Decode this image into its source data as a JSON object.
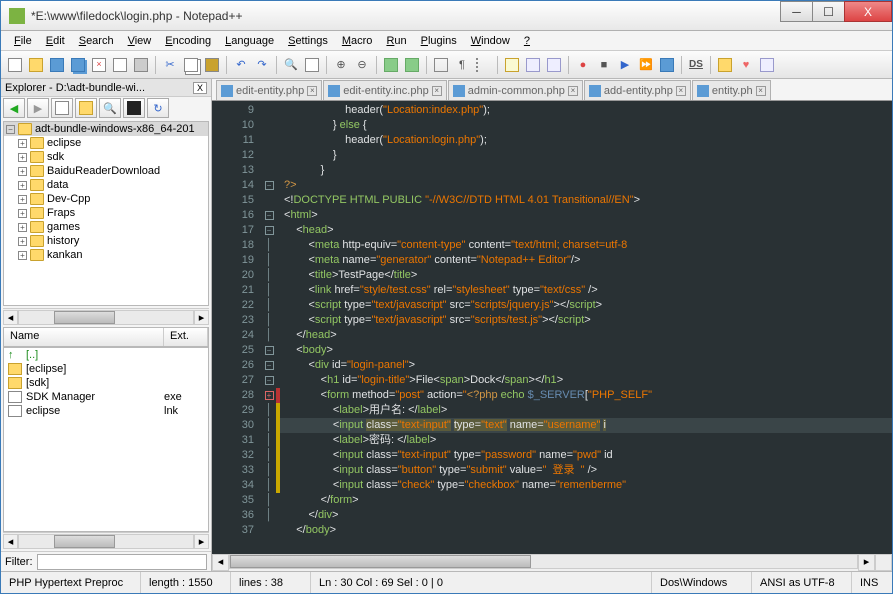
{
  "title": "*E:\\www\\filedock\\login.php - Notepad++",
  "win_buttons": {
    "min": "─",
    "max": "☐",
    "close": "X"
  },
  "menus": [
    "File",
    "Edit",
    "Search",
    "View",
    "Encoding",
    "Language",
    "Settings",
    "Macro",
    "Run",
    "Plugins",
    "Window",
    "?"
  ],
  "explorer": {
    "title": "Explorer - D:\\adt-bundle-wi...",
    "close": "X",
    "root": "adt-bundle-windows-x86_64-201",
    "tree": [
      "eclipse",
      "sdk",
      "BaiduReaderDownload",
      "data",
      "Dev-Cpp",
      "Fraps",
      "games",
      "history",
      "kankan"
    ],
    "cols": {
      "name": "Name",
      "ext": "Ext."
    },
    "files": [
      {
        "icon": "up",
        "name": "[..]",
        "ext": ""
      },
      {
        "icon": "folder",
        "name": "[eclipse]",
        "ext": ""
      },
      {
        "icon": "folder",
        "name": "[sdk]",
        "ext": ""
      },
      {
        "icon": "file",
        "name": "SDK Manager",
        "ext": "exe"
      },
      {
        "icon": "file",
        "name": "eclipse",
        "ext": "lnk"
      }
    ],
    "filter_label": "Filter:",
    "filter_value": ""
  },
  "tabs": [
    "edit-entity.php",
    "edit-entity.inc.php",
    "admin-common.php",
    "add-entity.php",
    "entity.ph"
  ],
  "line_start": 9,
  "line_count": 29,
  "status": {
    "lang": "PHP Hypertext Preproc",
    "length": "length : 1550",
    "lines": "lines : 38",
    "pos": "Ln : 30   Col : 69   Sel : 0 | 0",
    "eol": "Dos\\Windows",
    "enc": "ANSI as UTF-8",
    "ins": "INS"
  }
}
